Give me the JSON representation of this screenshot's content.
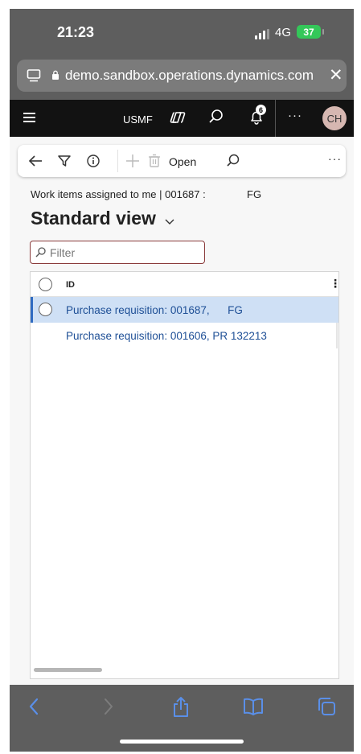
{
  "status_bar": {
    "time": "21:23",
    "network": "4G",
    "battery": "37"
  },
  "browser": {
    "url": "demo.sandbox.operations.dynamics.com",
    "close_symbol": "✕"
  },
  "nav": {
    "company": "USMF",
    "notification_count": "6",
    "more_symbol": "···",
    "avatar_initials": "CH"
  },
  "action_bar": {
    "open_label": "Open",
    "more_symbol": "···"
  },
  "breadcrumb": {
    "text": "Work items assigned to me  |  001687 :",
    "suffix": "FG"
  },
  "view": {
    "title": "Standard view"
  },
  "filter": {
    "placeholder": "Filter"
  },
  "grid": {
    "column_header": "ID",
    "kebab": "⋮",
    "rows": [
      {
        "text": "Purchase requisition: 001687,      FG",
        "selected": true
      },
      {
        "text": "Purchase requisition: 001606, PR 132213",
        "selected": false
      }
    ]
  },
  "colors": {
    "nav_bg": "#121212",
    "browser_chrome": "#5e5e5e",
    "selected_row": "#cfe0f5",
    "link_text": "#1e4f96",
    "filter_border": "#8a3b3b",
    "battery": "#34c759"
  },
  "icons": {
    "back": "back-arrow-icon",
    "filter": "filter-funnel-icon",
    "info": "info-icon",
    "add": "plus-icon",
    "delete": "trash-icon",
    "search": "search-icon",
    "copilot": "copilot-icon",
    "bell": "bell-icon",
    "hamburger": "hamburger-menu-icon",
    "share": "share-icon",
    "bookmarks": "book-icon",
    "tabs": "tabs-icon"
  }
}
